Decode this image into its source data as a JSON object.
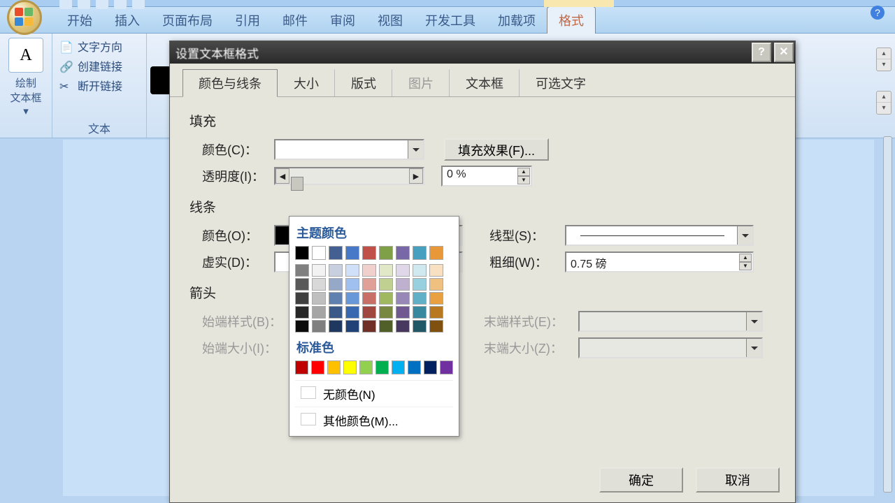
{
  "ribbon": {
    "tabs": [
      "开始",
      "插入",
      "页面布局",
      "引用",
      "邮件",
      "审阅",
      "视图",
      "开发工具",
      "加载项",
      "格式"
    ],
    "active_tab": "格式",
    "help": "?"
  },
  "panel": {
    "text_box_btn": "A",
    "draw_label_1": "绘制",
    "draw_label_2": "文本框",
    "text_direction": "文字方向",
    "create_link": "创建链接",
    "break_link": "断开链接",
    "group_label": "文本"
  },
  "dialog": {
    "title": "设置文本框格式",
    "help": "?",
    "close": "✕",
    "tabs": {
      "t1": "颜色与线条",
      "t2": "大小",
      "t3": "版式",
      "t4": "图片",
      "t5": "文本框",
      "t6": "可选文字"
    },
    "fill": {
      "header": "填充",
      "color_lbl": "颜色(C)：",
      "effects_btn": "填充效果(F)...",
      "transparency_lbl": "透明度(I)：",
      "transparency_val": "0 %"
    },
    "line": {
      "header": "线条",
      "color_lbl": "颜色(O)：",
      "dash_lbl": "虚实(D)：",
      "style_lbl": "线型(S)：",
      "weight_lbl": "粗细(W)：",
      "weight_val": "0.75 磅"
    },
    "arrow": {
      "header": "箭头",
      "begin_style": "始端样式(B)：",
      "begin_size": "始端大小(I)：",
      "end_style": "末端样式(E)：",
      "end_size": "末端大小(Z)："
    },
    "ok": "确定",
    "cancel": "取消"
  },
  "color_picker": {
    "theme_label": "主题颜色",
    "standard_label": "标准色",
    "no_color": "无颜色(N)",
    "more_colors": "其他颜色(M)...",
    "theme_top": [
      "#000000",
      "#ffffff",
      "#445f91",
      "#4878c8",
      "#c05048",
      "#80a048",
      "#7868a8",
      "#48a0c0",
      "#e89838"
    ],
    "theme_cols": [
      [
        "#7f7f7f",
        "#595959",
        "#3f3f3f",
        "#262626",
        "#0c0c0c"
      ],
      [
        "#f2f2f2",
        "#d8d8d8",
        "#bfbfbf",
        "#a5a5a5",
        "#7f7f7f"
      ],
      [
        "#c8d0e0",
        "#95a8c8",
        "#6080b0",
        "#3a5888",
        "#1f3860"
      ],
      [
        "#d0e0f8",
        "#a0c0f0",
        "#6898d8",
        "#3868b0",
        "#204078"
      ],
      [
        "#f0d0cc",
        "#e0a098",
        "#c87068",
        "#a04840",
        "#703028"
      ],
      [
        "#e0e8c8",
        "#c0d090",
        "#a0b860",
        "#788840",
        "#506028"
      ],
      [
        "#e0d8e8",
        "#c0b0d0",
        "#9888b8",
        "#705890",
        "#483860"
      ],
      [
        "#d0e8f0",
        "#98d0e0",
        "#60b0c8",
        "#3888a0",
        "#205868"
      ],
      [
        "#f8e0c0",
        "#f0c080",
        "#e8a040",
        "#b87820",
        "#805010"
      ]
    ],
    "standard": [
      "#c00000",
      "#ff0000",
      "#ffc000",
      "#ffff00",
      "#92d050",
      "#00b050",
      "#00b0f0",
      "#0070c0",
      "#002060",
      "#7030a0"
    ]
  }
}
